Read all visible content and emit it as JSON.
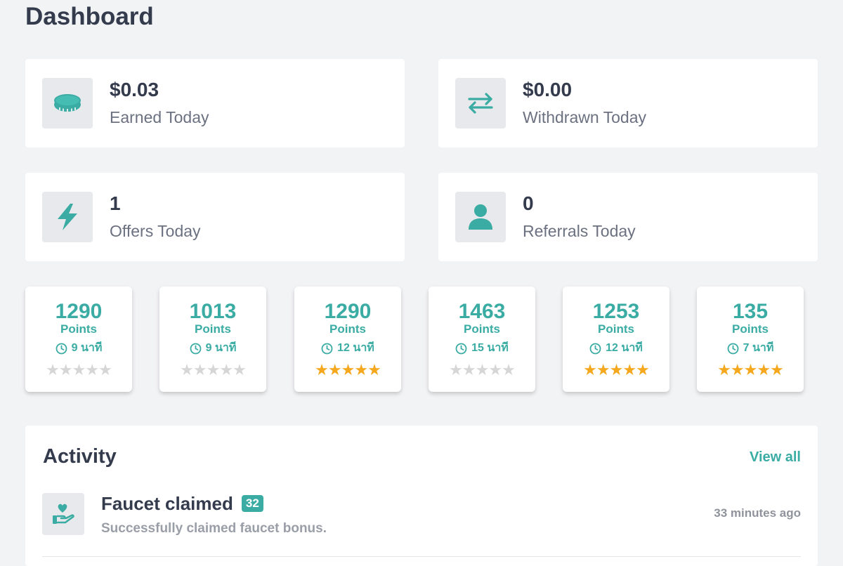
{
  "page": {
    "title": "Dashboard"
  },
  "stats": [
    {
      "value": "$0.03",
      "label": "Earned Today",
      "icon": "coin-icon"
    },
    {
      "value": "$0.00",
      "label": "Withdrawn Today",
      "icon": "transfer-arrows-icon"
    },
    {
      "value": "1",
      "label": "Offers Today",
      "icon": "lightning-icon"
    },
    {
      "value": "0",
      "label": "Referrals Today",
      "icon": "user-icon"
    }
  ],
  "offers": [
    {
      "points": "1290",
      "unit": "Points",
      "time": "9 นาที",
      "rating": 0
    },
    {
      "points": "1013",
      "unit": "Points",
      "time": "9 นาที",
      "rating": 0
    },
    {
      "points": "1290",
      "unit": "Points",
      "time": "12 นาที",
      "rating": 5
    },
    {
      "points": "1463",
      "unit": "Points",
      "time": "15 นาที",
      "rating": 0
    },
    {
      "points": "1253",
      "unit": "Points",
      "time": "12 นาที",
      "rating": 5
    },
    {
      "points": "135",
      "unit": "Points",
      "time": "7 นาที",
      "rating": 5
    }
  ],
  "activity": {
    "title": "Activity",
    "view_all": "View all",
    "items": [
      {
        "title": "Faucet claimed",
        "badge": "32",
        "description": "Successfully claimed faucet bonus.",
        "time": "33 minutes ago",
        "icon": "hand-heart-icon"
      }
    ]
  },
  "colors": {
    "accent": "#3aaca3",
    "star_on": "#f5a81e",
    "star_off": "#d6d6d6",
    "background": "#f2f3f5"
  }
}
